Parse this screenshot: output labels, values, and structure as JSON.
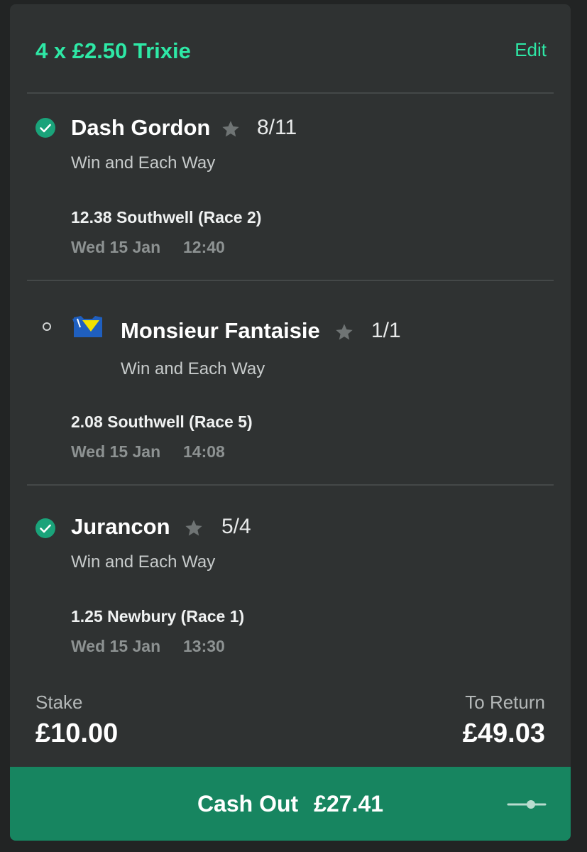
{
  "bet": {
    "title": "4 x £2.50 Trixie",
    "edit_label": "Edit"
  },
  "selections": [
    {
      "status": "won",
      "status_icon": "check-circle-icon",
      "name": "Dash Gordon",
      "odds": "8/11",
      "market": "Win and Each Way",
      "race": "12.38 Southwell (Race 2)",
      "date": "Wed 15 Jan",
      "time": "12:40"
    },
    {
      "status": "pending",
      "status_icon": "open-circle-icon",
      "silks": "jockey-silks-icon",
      "name": "Monsieur Fantaisie",
      "odds": "1/1",
      "market": "Win and Each Way",
      "race": "2.08 Southwell (Race 5)",
      "date": "Wed 15 Jan",
      "time": "14:08"
    },
    {
      "status": "won",
      "status_icon": "check-circle-icon",
      "name": "Jurancon",
      "odds": "5/4",
      "market": "Win and Each Way",
      "race": "1.25 Newbury (Race 1)",
      "date": "Wed 15 Jan",
      "time": "13:30"
    }
  ],
  "summary": {
    "stake_label": "Stake",
    "stake_value": "£10.00",
    "return_label": "To Return",
    "return_value": "£49.03"
  },
  "cashout": {
    "label": "Cash Out",
    "amount": "£27.41"
  },
  "colors": {
    "accent": "#2ee8a6",
    "card_bg": "#2f3232",
    "cashout_bg": "#178560",
    "check_bg": "#1aa37a"
  }
}
